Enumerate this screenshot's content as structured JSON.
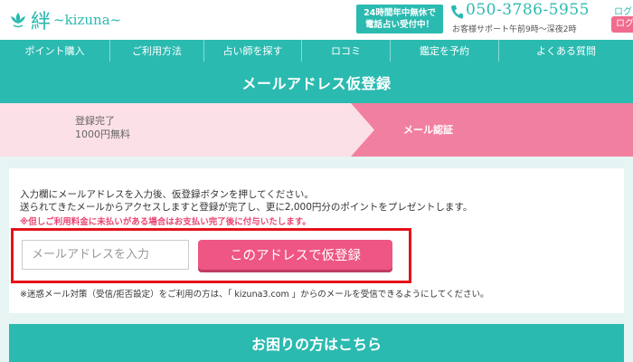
{
  "header": {
    "logo_kanji": "絆",
    "logo_roman": "~kizuna~",
    "logo_icon": "lotus-flower-icon",
    "badge_line1": "24時間年中無休で",
    "badge_line2": "電話占い受付中！",
    "phone_icon": "phone-icon",
    "phone_number": "050-3786-5955",
    "phone_note": "お客様サポート午前9時〜深夜2時",
    "login_text": "ログア",
    "login_button": "ログ",
    "brand_color": "#2bbab0",
    "accent_color": "#f06b8d"
  },
  "nav": {
    "items": [
      {
        "label": "ポイント購入"
      },
      {
        "label": "ご利用方法"
      },
      {
        "label": "占い師を探す"
      },
      {
        "label": "ロコミ"
      },
      {
        "label": "鑑定を予約"
      },
      {
        "label": "よくある質問"
      }
    ]
  },
  "page": {
    "title": "メールアドレス仮登録"
  },
  "steps": {
    "step1_line1": "登録完了",
    "step1_line2": "1000円無料",
    "step2_label": "メール認証",
    "active_color": "#f180a0"
  },
  "form": {
    "desc_line1": "入力欄にメールアドレスを入力後、仮登録ボタンを押してください。",
    "desc_line2": "送られてきたメールからアクセスしますと登録が完了し、更に2,000円分のポイントをプレゼントします。",
    "warning": "※但しご利用料金に未払いがある場合はお支払い完了後に付与いたします。",
    "email_placeholder": "メールアドレスを入力",
    "email_value": "",
    "submit_label": "このアドレスで仮登録",
    "note": "※迷惑メール対策（受信/拒否設定）をご利用の方は、「 kizuna3.com 」からのメールを受信できるようにしてください。",
    "highlight_color": "#e4131a"
  },
  "help": {
    "title": "お困りの方はこちら"
  }
}
